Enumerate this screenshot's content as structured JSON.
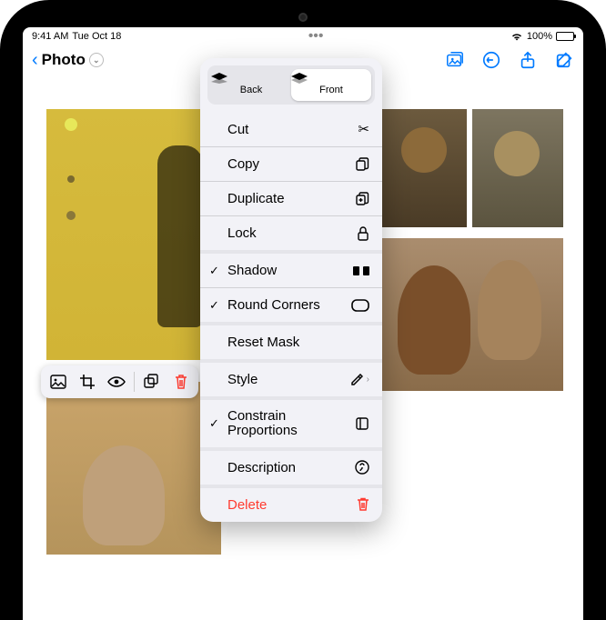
{
  "statusbar": {
    "time": "9:41 AM",
    "date": "Tue Oct 18",
    "wifi": true,
    "battery_pct": "100%"
  },
  "navbar": {
    "back_icon": "chevron-left",
    "title": "Photo",
    "title_disclosure": "chevron-down",
    "actions": {
      "insert_photo": "insert-photo-icon",
      "undo": "undo-icon",
      "share": "share-icon",
      "compose": "compose-icon"
    }
  },
  "selection_toolbar": {
    "items": [
      "image-icon",
      "crop-icon",
      "visibility-icon",
      "stack-icon",
      "trash-icon"
    ]
  },
  "popover": {
    "segments": {
      "back": "Back",
      "front": "Front",
      "active": "front"
    },
    "menu": [
      {
        "label": "Cut",
        "icon": "scissors-icon",
        "checked": false
      },
      {
        "label": "Copy",
        "icon": "copy-icon",
        "checked": false
      },
      {
        "label": "Duplicate",
        "icon": "duplicate-icon",
        "checked": false
      },
      {
        "label": "Lock",
        "icon": "lock-icon",
        "checked": false
      },
      {
        "label": "Shadow",
        "icon": "shadow-icon",
        "checked": true,
        "group": true
      },
      {
        "label": "Round Corners",
        "icon": "rounded-rect-icon",
        "checked": true
      },
      {
        "label": "Reset Mask",
        "icon": "",
        "checked": false,
        "group": true
      },
      {
        "label": "Style",
        "icon": "eyedropper-icon",
        "checked": false,
        "disclosure": true,
        "group": true
      },
      {
        "label": "Constrain Proportions",
        "icon": "constrain-icon",
        "checked": true,
        "group": true,
        "twoLine": true
      },
      {
        "label": "Description",
        "icon": "info-icon",
        "checked": false,
        "group": true
      },
      {
        "label": "Delete",
        "icon": "trash-icon",
        "checked": false,
        "destructive": true,
        "group": true
      }
    ]
  },
  "colors": {
    "tint": "#007aff",
    "destructive": "#ff3b30",
    "popover_bg": "#f2f2f7"
  }
}
